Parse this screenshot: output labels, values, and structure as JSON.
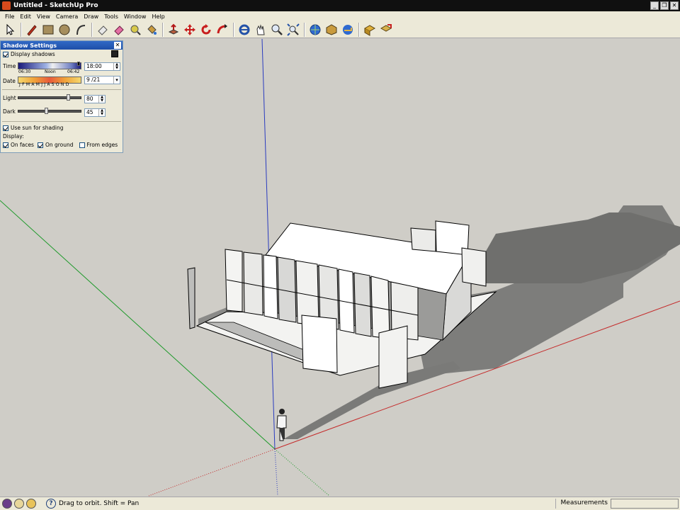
{
  "window": {
    "title": "Untitled - SketchUp Pro"
  },
  "menu": [
    "File",
    "Edit",
    "View",
    "Camera",
    "Draw",
    "Tools",
    "Window",
    "Help"
  ],
  "toolbar": {
    "tools": [
      "select-icon",
      "pencil-icon",
      "rectangle-icon",
      "circle-icon",
      "arc-icon",
      "eraser-icon",
      "paint-eraser-icon",
      "tape-measure-icon",
      "paint-bucket-icon",
      "push-pull-icon",
      "move-icon",
      "rotate-icon",
      "follow-me-icon",
      "orbit-icon",
      "pan-icon",
      "zoom-icon",
      "zoom-extents-icon",
      "warehouse-icon",
      "components-icon",
      "share-icon",
      "layout-icon",
      "send-icon"
    ]
  },
  "shadow_settings": {
    "title": "Shadow Settings",
    "display_shadows": "Display shadows",
    "time_label": "Time",
    "time_start": "06:30",
    "time_noon": "Noon",
    "time_end": "06:42",
    "time_value": "18:00",
    "date_label": "Date",
    "months": "J F M A M J J A S O N D",
    "date_value": "9 /21",
    "light_label": "Light",
    "light_value": "80",
    "dark_label": "Dark",
    "dark_value": "45",
    "use_sun": "Use sun for shading",
    "display_label": "Display:",
    "on_faces": "On faces",
    "on_ground": "On ground",
    "from_edges": "From edges",
    "light_level": 0.8,
    "dark_level": 0.45
  },
  "status": {
    "hint": "Drag to orbit.  Shift = Pan",
    "measurements_label": "Measurements",
    "measurements_value": ""
  }
}
